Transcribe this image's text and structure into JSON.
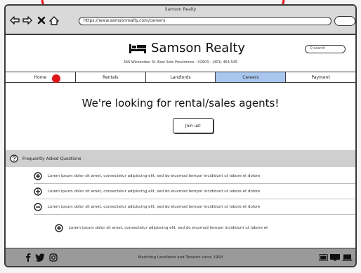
{
  "window": {
    "title": "Samson Realty",
    "url": "https://www.samsonrealty.com/careers"
  },
  "colors": {
    "active_tab": "#a9c6ee",
    "faq_bar": "#cfcfcf",
    "footer_bg": "#9a9a9a",
    "annotation": "#e0141b"
  },
  "header": {
    "brand_name": "Samson Realty",
    "brand_icon": "bed-icon",
    "address": "346 Wickenden St. East Side Providence - 02903 - (401) 454-545",
    "search_placeholder": "Q search"
  },
  "nav": {
    "tabs": [
      {
        "label": "Home",
        "active": false
      },
      {
        "label": "Rentals",
        "active": false
      },
      {
        "label": "Landlords",
        "active": false
      },
      {
        "label": "Careers",
        "active": true
      },
      {
        "label": "Payment",
        "active": false
      }
    ]
  },
  "hero": {
    "title": "We're looking for rental/sales agents!",
    "button_label": "Join us!"
  },
  "faq": {
    "title": "Frequently Asked Questions",
    "items": [
      {
        "icon": "plus-circle-icon",
        "text": "Lorem ipsum dolor sit amet, consectetur adipiscing elit, sed do eiusmod tempor incididunt ut labore et dolore"
      },
      {
        "icon": "plus-circle-icon",
        "text": "Lorem ipsum dolor sit amet, consectetur adipiscing elit, sed do eiusmod tempor incididunt ut labore et dolore"
      },
      {
        "icon": "minus-circle-icon",
        "text": "Lorem ipsum dolor sit amet, consectetur adipiscing elit, sed do eiusmod tempor incididunt ut labore et dolore"
      },
      {
        "icon": "plus-circle-icon",
        "text": "Lorem ipsum dolor sit amet, consectetur adipiscing elit, sed do eiusmod tempor incididunt ut labore et"
      }
    ]
  },
  "footer": {
    "tagline": "Matching Landlords and Tenants since 1993",
    "social_icons": [
      "facebook-icon",
      "twitter-icon",
      "instagram-icon"
    ],
    "device_icons": [
      "tablet-icon",
      "desktop-icon",
      "laptop-icon"
    ]
  }
}
